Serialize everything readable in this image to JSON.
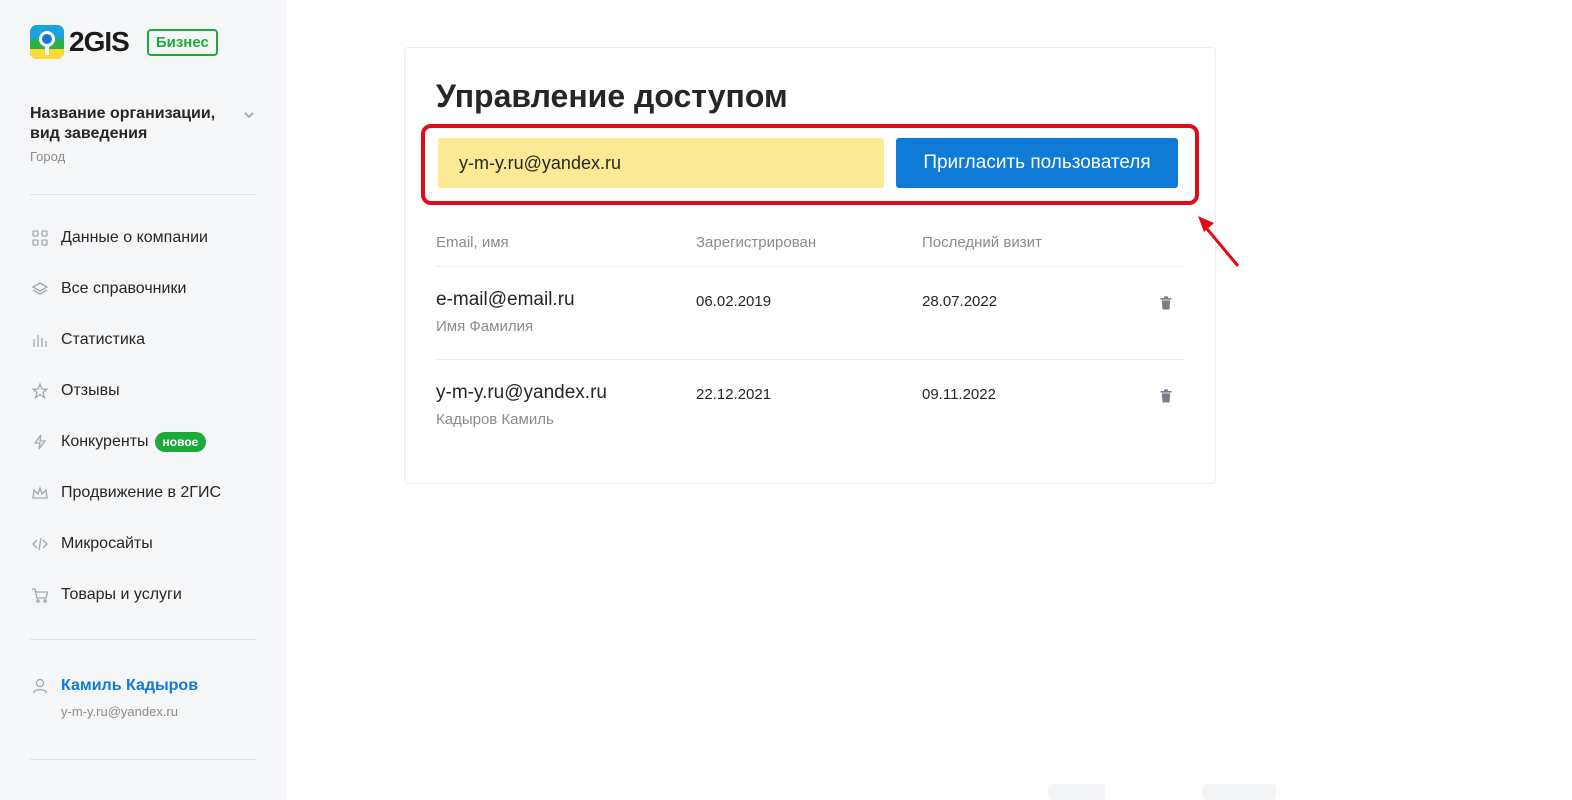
{
  "brand": {
    "logo_text": "2GIS",
    "badge": "Бизнес"
  },
  "organization": {
    "name": "Название организации, вид заведения",
    "city": "Город"
  },
  "nav": {
    "items": [
      {
        "label": "Данные о компании",
        "icon": "grid-icon"
      },
      {
        "label": "Все справочники",
        "icon": "layers-icon"
      },
      {
        "label": "Статистика",
        "icon": "bar-chart-icon"
      },
      {
        "label": "Отзывы",
        "icon": "star-icon"
      },
      {
        "label": "Конкуренты",
        "icon": "lightning-icon",
        "badge": "новое"
      },
      {
        "label": "Продвижение в 2ГИС",
        "icon": "crown-icon"
      },
      {
        "label": "Микросайты",
        "icon": "code-icon"
      },
      {
        "label": "Товары и услуги",
        "icon": "cart-icon"
      }
    ]
  },
  "user": {
    "name": "Камиль Кадыров",
    "email": "y-m-y.ru@yandex.ru"
  },
  "main": {
    "title": "Управление доступом",
    "invite": {
      "email_value": "y-m-y.ru@yandex.ru",
      "button_label": "Пригласить пользователя"
    },
    "table": {
      "headers": [
        "Email, имя",
        "Зарегистрирован",
        "Последний визит"
      ],
      "rows": [
        {
          "email": "e-mail@email.ru",
          "name": "Имя Фамилия",
          "registered": "06.02.2019",
          "last_visit": "28.07.2022"
        },
        {
          "email": "y-m-y.ru@yandex.ru",
          "name": "Кадыров Камиль",
          "registered": "22.12.2021",
          "last_visit": "09.11.2022"
        }
      ]
    }
  },
  "colors": {
    "accent_blue": "#0f7bd7",
    "brand_green": "#1baa3c",
    "input_highlight": "#fbe993",
    "annotation_red": "#e10b18"
  }
}
